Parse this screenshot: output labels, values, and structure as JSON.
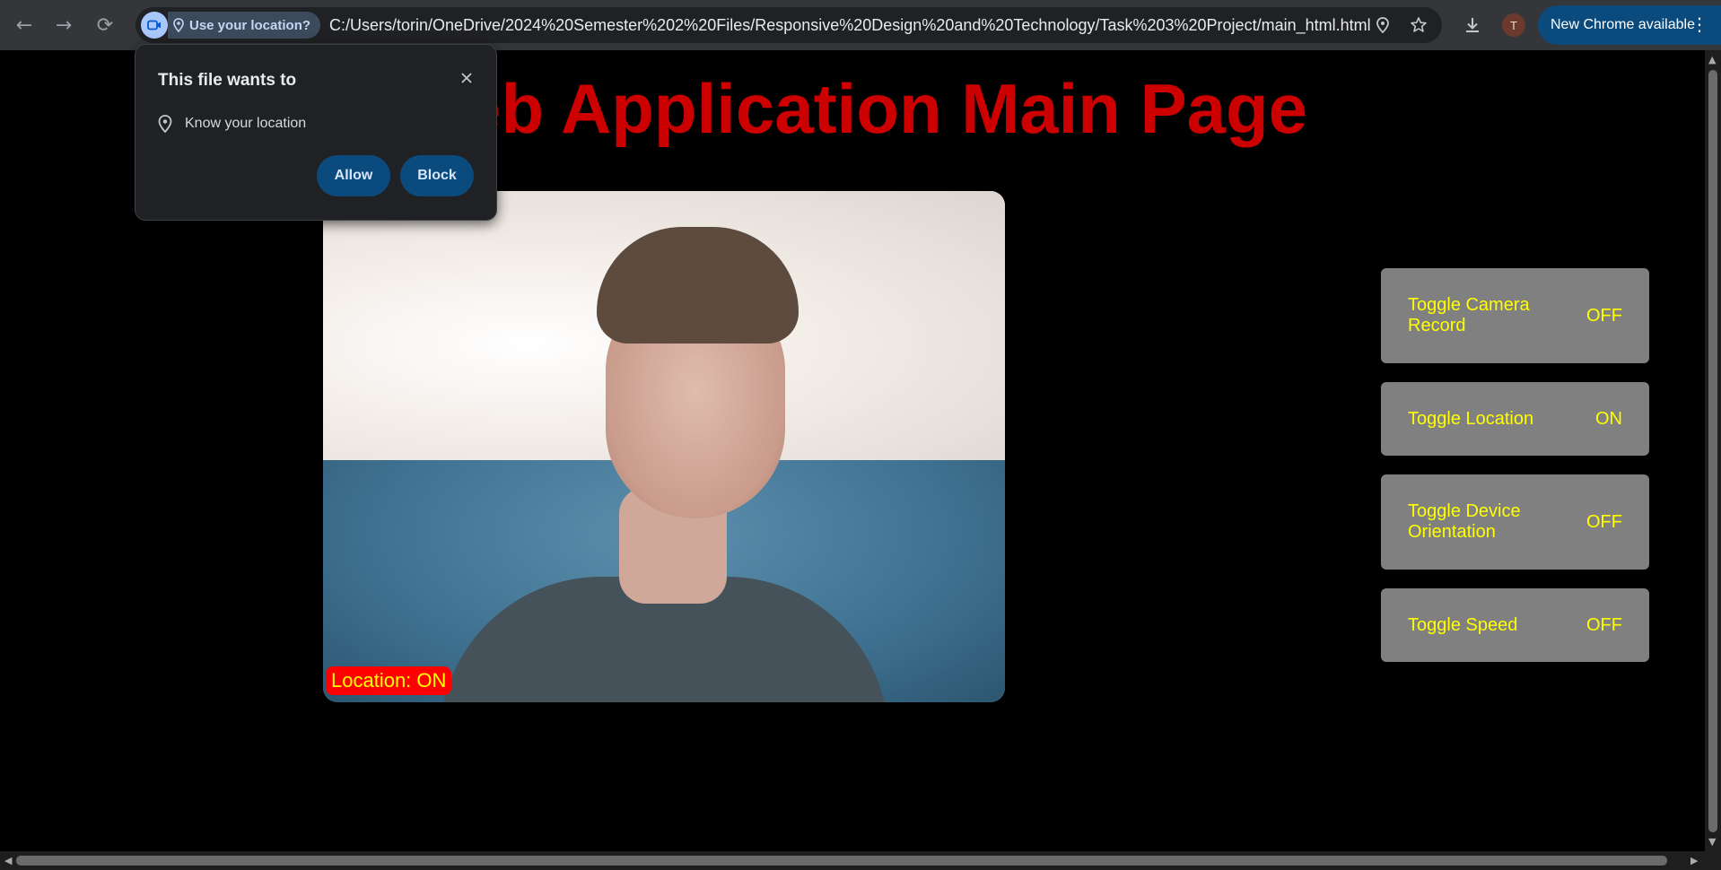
{
  "browser": {
    "back_icon": "←",
    "forward_icon": "→",
    "reload_icon": "⟳",
    "location_chip": "Use your location?",
    "url": "C:/Users/torin/OneDrive/2024%20Semester%202%20Files/Responsive%20Design%20and%20Technology/Task%203%20Project/main_html.html",
    "profile_initial": "T",
    "update_label": "New Chrome available",
    "menu_icon": "⋮"
  },
  "popup": {
    "heading": "This file wants to",
    "permission": "Know your location",
    "allow_label": "Allow",
    "block_label": "Block",
    "close_icon": "✕"
  },
  "page": {
    "title": "Web Application Main Page",
    "location_overlay": "Location: ON"
  },
  "toggles": [
    {
      "label": "Toggle Camera Record",
      "state": "OFF"
    },
    {
      "label": "Toggle Location",
      "state": "ON"
    },
    {
      "label": "Toggle Device Orientation",
      "state": "OFF"
    },
    {
      "label": "Toggle Speed",
      "state": "OFF"
    }
  ],
  "colors": {
    "title": "#cc0000",
    "toggle_bg": "#808080",
    "toggle_text": "#ffff00",
    "overlay_bg": "#ff0000",
    "accent": "#0b4a7d"
  }
}
